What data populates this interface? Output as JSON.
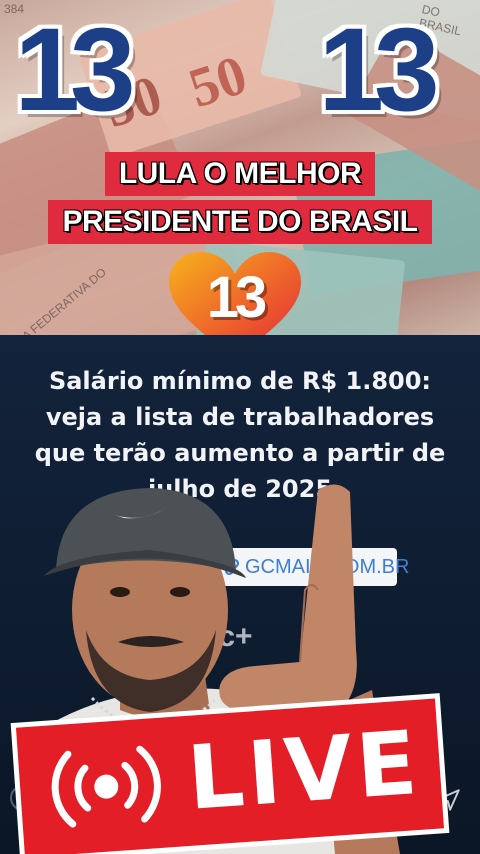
{
  "header": {
    "number_left": "13",
    "number_right": "13",
    "heart_number": "13",
    "bill_texts": [
      "384",
      "DO BRASIL",
      "50",
      "50",
      "CA FEDERATIVA DO"
    ]
  },
  "headline": {
    "line1": "LULA O MELHOR",
    "line2": "PRESIDENTE DO BRASIL"
  },
  "news": {
    "title_line1": "Salário mínimo de R$ 1.800:",
    "title_line2": "veja a lista de trabalhadores",
    "title_line3": "que terão aumento a partir de",
    "title_line4": "julho de 2025",
    "link_text": "GCMAIS.COM.BR",
    "watermark": "gc+"
  },
  "live": {
    "label": "LIVE"
  },
  "colors": {
    "blue_13": "#1d3f88",
    "red_banner": "#e02a3e",
    "live_red": "#e31e26",
    "news_bg": "#13233b",
    "link_blue": "#3f7fd1"
  },
  "icons": {
    "link": "link-icon",
    "broadcast": "broadcast-icon",
    "send": "send-icon",
    "heart": "heart-icon"
  }
}
